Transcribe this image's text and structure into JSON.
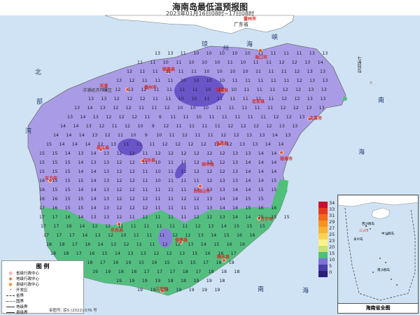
{
  "title": "海南岛最低温预报图",
  "subtitle": "2023年01月16日08时~17日08时",
  "sea_labels": {
    "qiongzhou": [
      "琼",
      "州",
      "海",
      "峡"
    ],
    "beibu": [
      "北",
      "部",
      "湾"
    ],
    "nanhai_left": [
      "南",
      "海"
    ],
    "nanhai_right": [
      "南",
      "海"
    ],
    "nanhai_top": [
      "南",
      "海"
    ]
  },
  "region_labels": {
    "guangdong": "广东省",
    "leizhou": "雷州市",
    "dev_zone": "洋浦经济开发区",
    "qizhou": "七洲列岛"
  },
  "cities": [
    "海口市",
    "文昌市",
    "琼海市",
    "万宁市",
    "陵水县",
    "三亚市",
    "乐东县",
    "东方市",
    "昌江县",
    "儋州市",
    "临高县",
    "澄迈县",
    "定安县",
    "屯昌县",
    "五指山市",
    "保亭县",
    "琼中县",
    "白沙县",
    "洋浦"
  ],
  "legend": {
    "title": "图 例",
    "items": [
      "省级行政中心",
      "地级行政中心",
      "县级行政中心",
      "开发区",
      "省界",
      "国界",
      "地级界",
      "县级界"
    ]
  },
  "approval": "审图号: 琼S (2022) 076 号",
  "colorbar": {
    "labels": [
      "34",
      "33",
      "31",
      "29",
      "27",
      "25",
      "23",
      "20",
      "15",
      "10",
      "5",
      "0"
    ],
    "colors": [
      "#c8102e",
      "#e83a1f",
      "#f26b1b",
      "#f7931e",
      "#f9b233",
      "#fcd450",
      "#fdf28a",
      "#c6e373",
      "#4ec07a",
      "#7b73d8",
      "#4b3ca8",
      "#2a1e7a"
    ]
  },
  "inset": {
    "caption": "海南省全图",
    "labels": [
      "西沙群岛",
      "中沙群岛",
      "南沙群岛",
      "三沙市",
      "永兴岛"
    ]
  },
  "temp_grid": {
    "rows": [
      "13 13 11 10 10 10 10 10 11 11 11 11 13 13",
      "11 11 10 11 10 10 10 11 10 11 11 12 12 13 14",
      "12 11 11 11 11 11 10 10 10 10 11 11 11 12 13 13",
      "13 12 11 11 11 10 10 10 10 11 11 11 11 11 12 13 13",
      "12 12 13 12 11 11 11 11 10 10 10 11 11 11 12 12 13 13",
      "13 13 12 12 12 11 11 10 10 11 11 11 11 11 11 12 12 13 13",
      "13 14 13 12 12 11 11 12 10 10 10 11 11 11 11 11 12 12 13 13",
      "13 14 13 12 12 12 11 9 11 11 10 11 11 11 11 11 12 12 13",
      "14 14 13 12 11 12 10 9 12 11 11 11 11 12 12 12 12 13 13",
      "14 14 14 13 12 11 10 9 10 11 12 11 11 12 12 13 13 14 13",
      "15 14 14 14 12 13 11 11 11 12 12 12 12 12 12 13 13 14 14",
      "15 15 14 13 14 13 12 12 11 12 12 12 12 12 12 13 13 14 14",
      "15 15 15 14 13 13 12 12 11 10 11 11 12 12 12 13 14 14 14",
      "15 15 15 14 14 13 12 12 11 10 11 12 12 12 12 13 14 14 14",
      "16 15 15 15 14 13 12 12 11 10 11 11 11 12 13 13 14 14 15",
      "16 15 15 14 14 13 12 12 11 11 11 11 12 13 13 14 14 15 15",
      "16 16 15 15 14 13 12 12 12 11 11 12 12 13 14 14 15 15",
      "17 16 15 15 14 13 12 12 12 11 11 11 11 13 14 14 15 16 16",
      "17 17 16 14 13 13 12 11 12 11 11 11 12 12 13 14 14 15 15 15",
      "17 17 16 14 12 12 11 11 11 11 11 11 12 13 14 15 15 15",
      "17 17 17 14 13 12 10 11 11 11 12 12 13 14 15 16 16",
      "18 18 17 16 14 13 12 11 11 12 12 13 14 15 16 16",
      "18 18 17 16 15 14 13 13 12 12 13 15 16 16 17",
      "18 18 17 16 16 15 16 15 15 15 17 18 18",
      "19 19 18 18 17 17 17 18 17 18 18 18",
      "19 19 19 19 18 18 19 19 18",
      "19 19 19 19 19 19 19"
    ]
  }
}
